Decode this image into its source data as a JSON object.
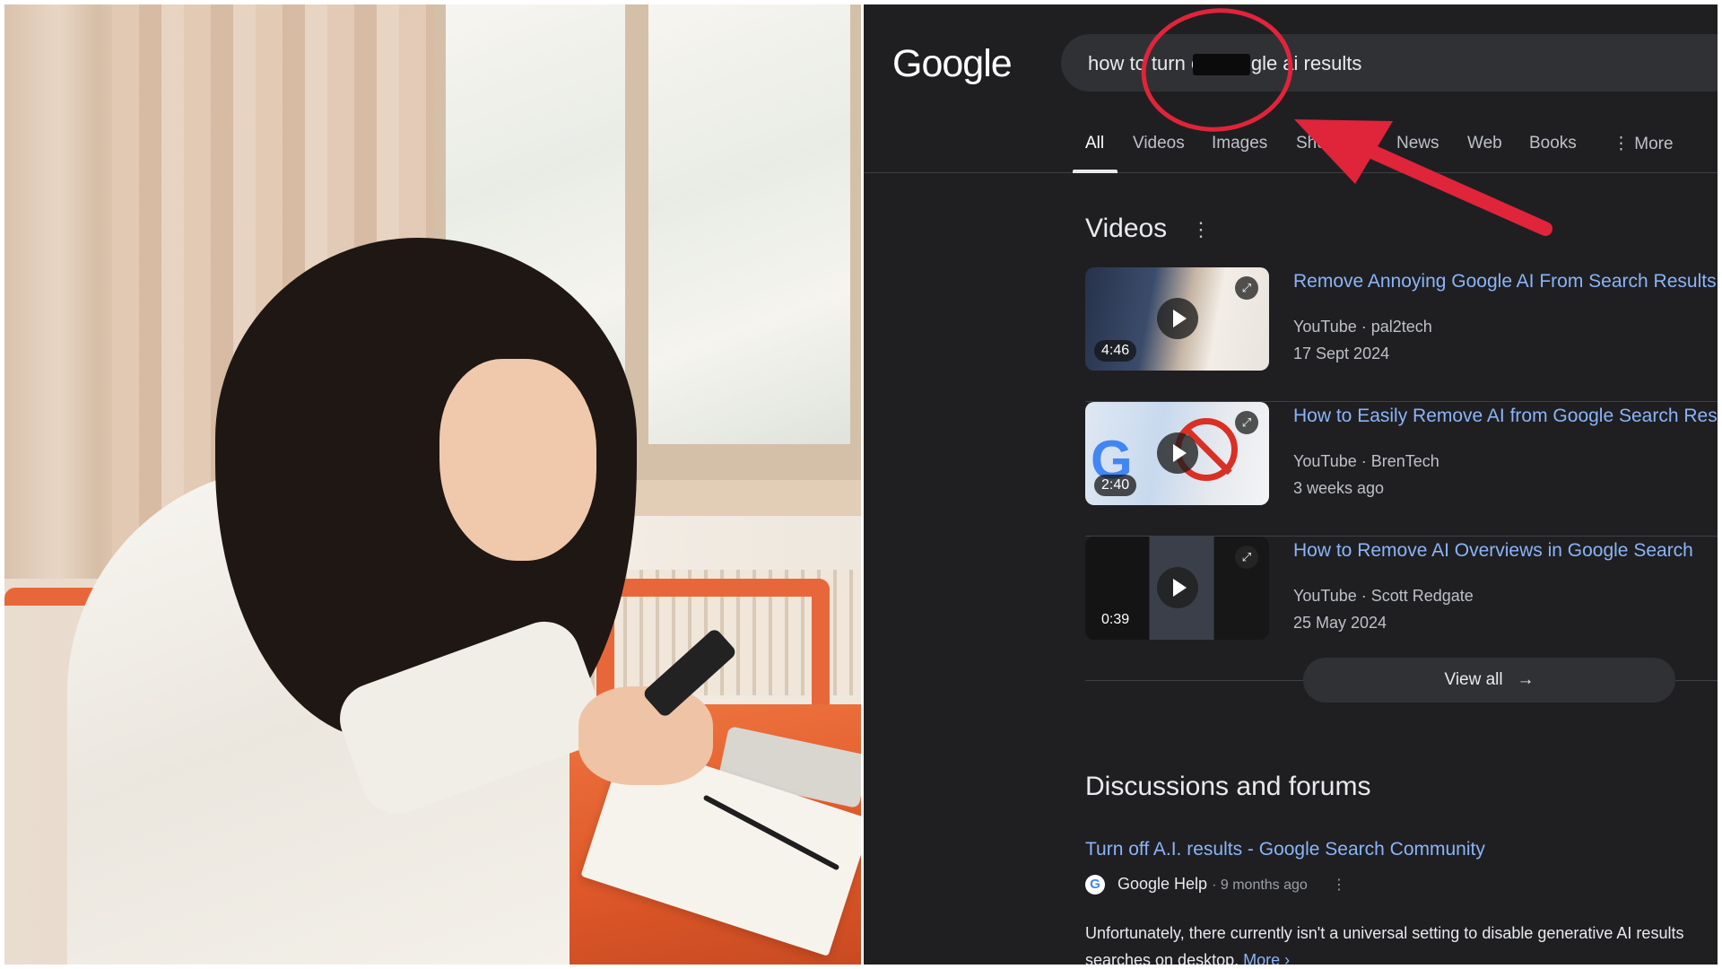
{
  "photo": {
    "alt": "Woman looking at smartphone at a table"
  },
  "google": {
    "logo": "Google",
    "search_query": "how to turn       off google ai results",
    "tabs": [
      "All",
      "Videos",
      "Images",
      "Shopping",
      "News",
      "Web",
      "Books",
      "More"
    ],
    "active_tab": "All",
    "videos_section": {
      "title": "Videos",
      "items": [
        {
          "title": "Remove Annoying Google AI From Search Results",
          "source": "YouTube · pal2tech",
          "date": "17 Sept 2024",
          "duration": "4:46"
        },
        {
          "title": "How to Easily Remove AI from Google Search Results",
          "source": "YouTube · BrenTech",
          "date": "3 weeks ago",
          "duration": "2:40"
        },
        {
          "title": "How to Remove AI Overviews in Google Search",
          "source": "YouTube · Scott Redgate",
          "date": "25 May 2024",
          "duration": "0:39"
        }
      ],
      "view_all": "View all"
    },
    "discussions_section": {
      "title": "Discussions and forums",
      "result_title": "Turn off A.I. results - Google Search Community",
      "site": "Google Help",
      "age": "· 9 months ago",
      "snippet_line1": "Unfortunately, there currently isn't a universal setting to disable generative AI results",
      "snippet_line2": "searches on desktop.",
      "more": "More ›"
    }
  },
  "colors": {
    "background": "#1f1f22",
    "link": "#8ab4f8",
    "annotation_red": "#e0243a"
  }
}
